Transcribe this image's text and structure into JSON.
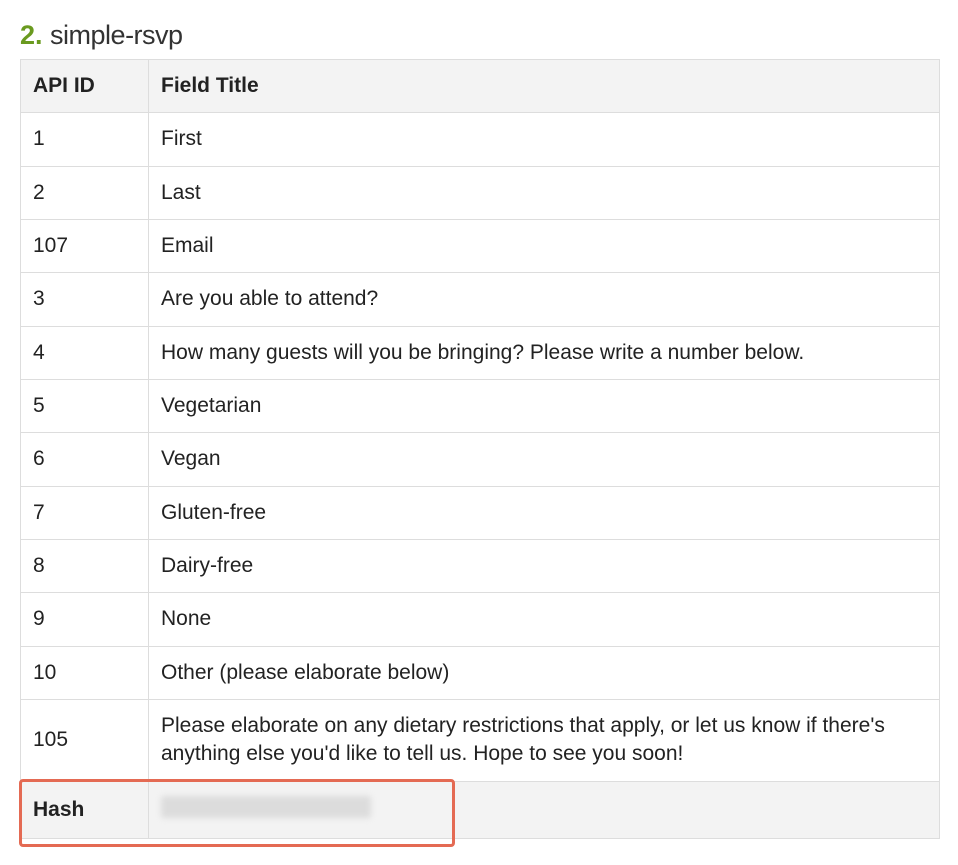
{
  "heading": {
    "number": "2.",
    "name": "simple-rsvp"
  },
  "columns": {
    "id": "API ID",
    "title": "Field Title"
  },
  "rows": [
    {
      "id": "1",
      "title": "First"
    },
    {
      "id": "2",
      "title": "Last"
    },
    {
      "id": "107",
      "title": "Email"
    },
    {
      "id": "3",
      "title": "Are you able to attend?"
    },
    {
      "id": "4",
      "title": "How many guests will you be bringing? Please write a number below."
    },
    {
      "id": "5",
      "title": "Vegetarian"
    },
    {
      "id": "6",
      "title": "Vegan"
    },
    {
      "id": "7",
      "title": "Gluten-free"
    },
    {
      "id": "8",
      "title": "Dairy-free"
    },
    {
      "id": "9",
      "title": "None"
    },
    {
      "id": "10",
      "title": "Other (please elaborate below)"
    },
    {
      "id": "105",
      "title": "Please elaborate on any dietary restrictions that apply, or let us know if there's anything else you'd like to tell us. Hope to see you soon!"
    }
  ],
  "footer": {
    "label": "Hash",
    "value_redacted": true
  }
}
